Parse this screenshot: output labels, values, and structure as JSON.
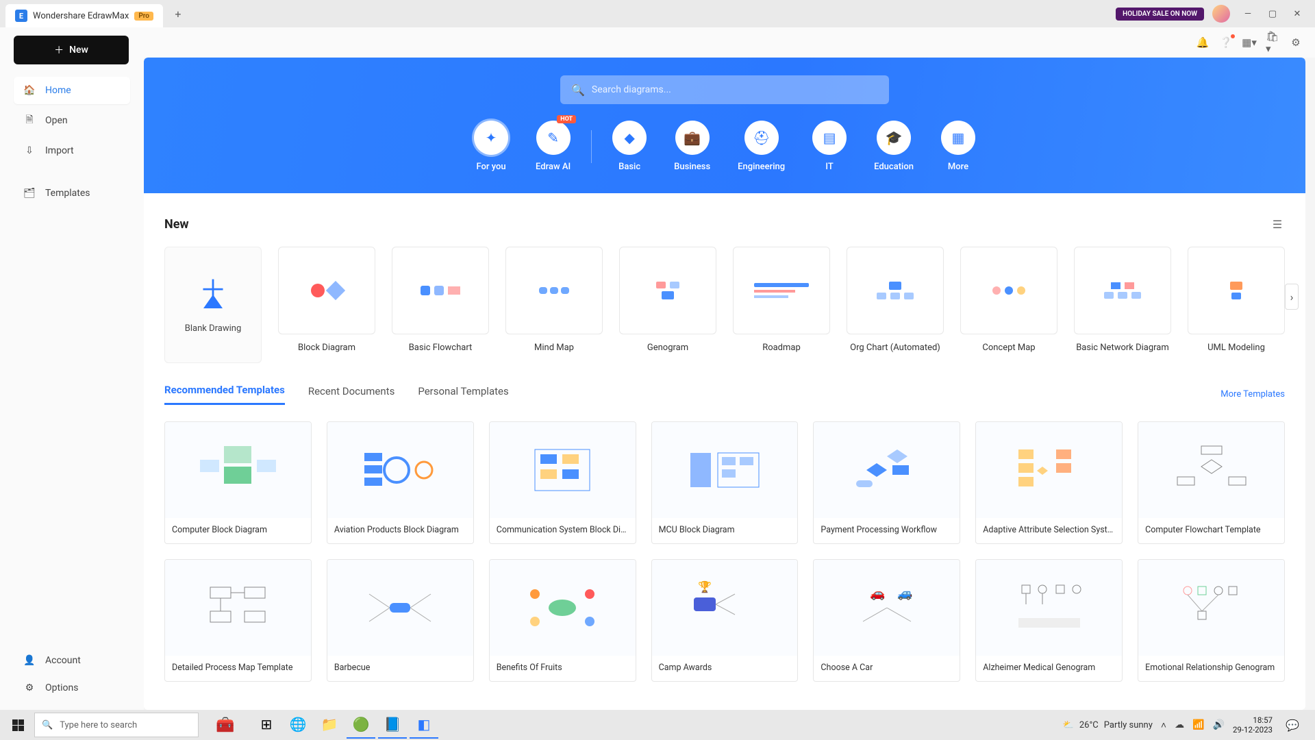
{
  "titlebar": {
    "app_name": "Wondershare EdrawMax",
    "pro": "Pro",
    "holiday": "HOLIDAY SALE ON NOW"
  },
  "sidebar": {
    "new_btn": "New",
    "items": [
      {
        "label": "Home",
        "icon": "🏠"
      },
      {
        "label": "Open",
        "icon": "📄"
      },
      {
        "label": "Import",
        "icon": "📥"
      }
    ],
    "templates": {
      "label": "Templates",
      "icon": "🗂"
    },
    "account": {
      "label": "Account",
      "icon": "👤"
    },
    "options": {
      "label": "Options",
      "icon": "⚙"
    }
  },
  "hero": {
    "search_placeholder": "Search diagrams...",
    "tabs": [
      {
        "label": "For you"
      },
      {
        "label": "Edraw AI",
        "hot": "HOT"
      },
      {
        "label": "Basic"
      },
      {
        "label": "Business"
      },
      {
        "label": "Engineering"
      },
      {
        "label": "IT"
      },
      {
        "label": "Education"
      },
      {
        "label": "More"
      }
    ]
  },
  "new_section": {
    "title": "New",
    "blank": "Blank Drawing",
    "items": [
      "Block Diagram",
      "Basic Flowchart",
      "Mind Map",
      "Genogram",
      "Roadmap",
      "Org Chart (Automated)",
      "Concept Map",
      "Basic Network Diagram",
      "UML Modeling"
    ]
  },
  "tabs": {
    "recommended": "Recommended Templates",
    "recent": "Recent Documents",
    "personal": "Personal Templates",
    "more": "More Templates"
  },
  "templates_row1": [
    "Computer Block Diagram",
    "Aviation Products Block Diagram",
    "Communication System Block Diag...",
    "MCU Block Diagram",
    "Payment Processing Workflow",
    "Adaptive Attribute Selection System",
    "Computer Flowchart Template"
  ],
  "templates_row2": [
    "Detailed Process Map Template",
    "Barbecue",
    "Benefits Of Fruits",
    "Camp Awards",
    "Choose A Car",
    "Alzheimer Medical Genogram",
    "Emotional Relationship Genogram"
  ],
  "taskbar": {
    "search": "Type here to search",
    "weather_temp": "26°C",
    "weather_desc": "Partly sunny",
    "time": "18:57",
    "date": "29-12-2023"
  }
}
